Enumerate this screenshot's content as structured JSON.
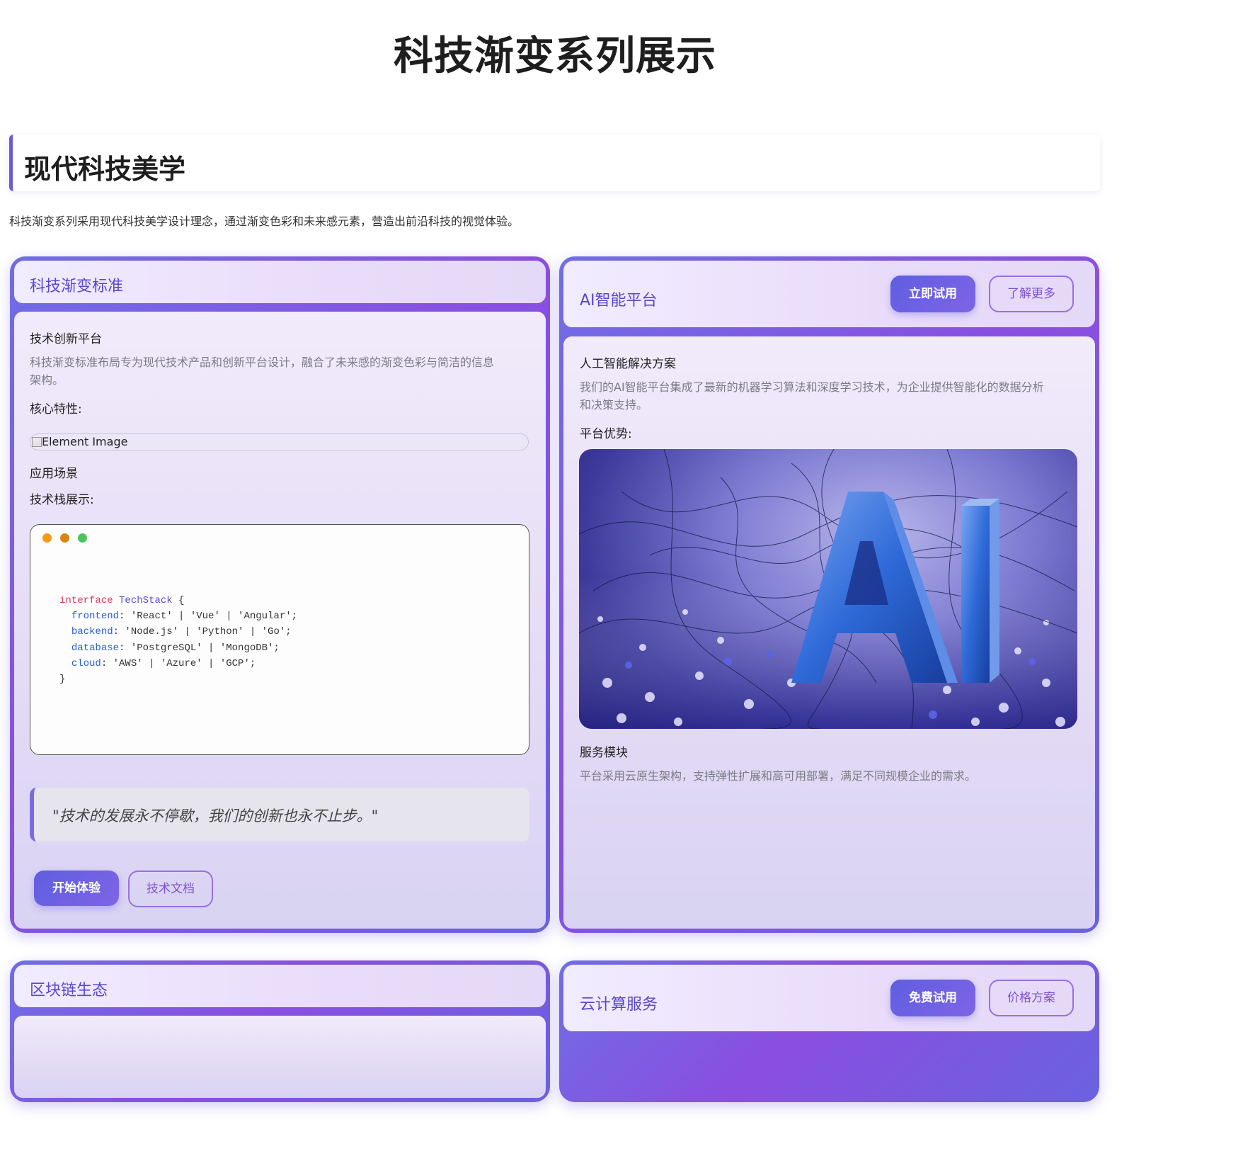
{
  "page": {
    "title": "科技渐变系列展示"
  },
  "section": {
    "title": "现代科技美学",
    "description": "科技渐变系列采用现代科技美学设计理念，通过渐变色彩和未来感元素，营造出前沿科技的视觉体验。"
  },
  "card_standard": {
    "title": "科技渐变标准",
    "subtitle": "技术创新平台",
    "description_line1": "科技渐变标准布局专为现代技术产品和创新平台设计，融合了未来感的渐变色彩与简洁的信息",
    "description_line2": "架构。",
    "features_label": "核心特性:",
    "image_alt": "Element Image",
    "scenarios_label": "应用场景",
    "stack_label": "技术栈展示:",
    "code": {
      "line1_kw": "interface",
      "line1_type": "TechStack",
      "line1_brace": " {",
      "line2_prop": "frontend",
      "line2_val": ": 'React' | 'Vue' | 'Angular';",
      "line3_prop": "backend",
      "line3_val": ": 'Node.js' | 'Python' | 'Go';",
      "line4_prop": "database",
      "line4_val": ": 'PostgreSQL' | 'MongoDB';",
      "line5_prop": "cloud",
      "line5_val": ": 'AWS' | 'Azure' | 'GCP';",
      "line6": "}"
    },
    "quote": "\"技术的发展永不停歇，我们的创新也永不止步。\"",
    "primary_button": "开始体验",
    "secondary_button": "技术文档"
  },
  "card_ai": {
    "title": "AI智能平台",
    "primary_button": "立即试用",
    "secondary_button": "了解更多",
    "subtitle": "人工智能解决方案",
    "description_line1": "我们的AI智能平台集成了最新的机器学习算法和深度学习技术，为企业提供智能化的数据分析",
    "description_line2": "和决策支持。",
    "advantages_label": "平台优势:",
    "image_text": "AI",
    "service_label": "服务模块",
    "service_desc": "平台采用云原生架构，支持弹性扩展和高可用部署，满足不同规模企业的需求。"
  },
  "card_blockchain": {
    "title": "区块链生态"
  },
  "card_cloud": {
    "title": "云计算服务",
    "primary_button": "免费试用",
    "secondary_button": "价格方案"
  },
  "colors": {
    "accent": "#5a48cc",
    "gradient_start": "#6f6ee6",
    "gradient_end": "#8a4ee0",
    "dot_red": "#f59a16",
    "dot_yellow": "#d98514",
    "dot_green": "#4cc45c"
  }
}
